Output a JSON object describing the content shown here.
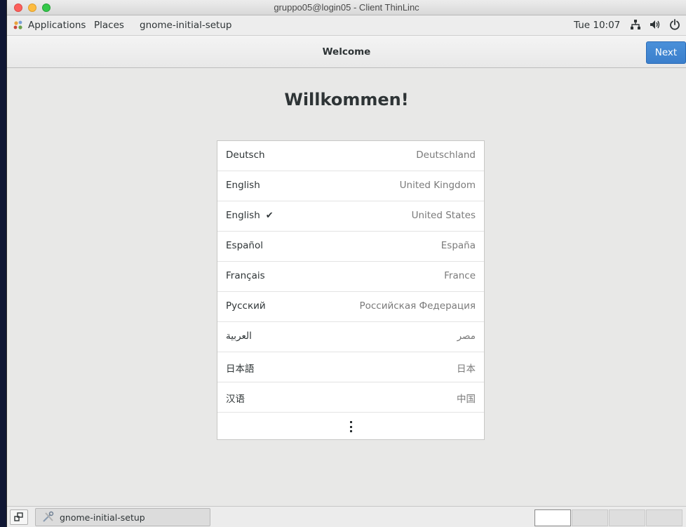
{
  "window": {
    "title": "gruppo05@login05 - Client ThinLinc"
  },
  "colors": {
    "close": "#fc605c",
    "minimize": "#fdbc40",
    "zoom": "#34c84a",
    "accent": "#3b7fcc"
  },
  "topbar": {
    "applications": "Applications",
    "places": "Places",
    "app_menu": "gnome-initial-setup",
    "clock": "Tue 10:07",
    "icons": [
      "network-icon",
      "volume-icon",
      "power-icon"
    ]
  },
  "headerbar": {
    "title": "Welcome",
    "next": "Next"
  },
  "main": {
    "heading": "Willkommen!",
    "languages": [
      {
        "name": "Deutsch",
        "region": "Deutschland",
        "selected": false
      },
      {
        "name": "English",
        "region": "United Kingdom",
        "selected": false
      },
      {
        "name": "English",
        "region": "United States",
        "selected": true,
        "check": "✔"
      },
      {
        "name": "Español",
        "region": "España",
        "selected": false
      },
      {
        "name": "Français",
        "region": "France",
        "selected": false
      },
      {
        "name": "Русский",
        "region": "Российская Федерация",
        "selected": false
      },
      {
        "name": "العربية",
        "region": "مصر",
        "selected": false
      },
      {
        "name": "日本語",
        "region": "日本",
        "selected": false
      },
      {
        "name": "汉语",
        "region": "中国",
        "selected": false
      }
    ]
  },
  "taskbar": {
    "window_label": "gnome-initial-setup",
    "workspaces": 4,
    "active_workspace": 1
  }
}
